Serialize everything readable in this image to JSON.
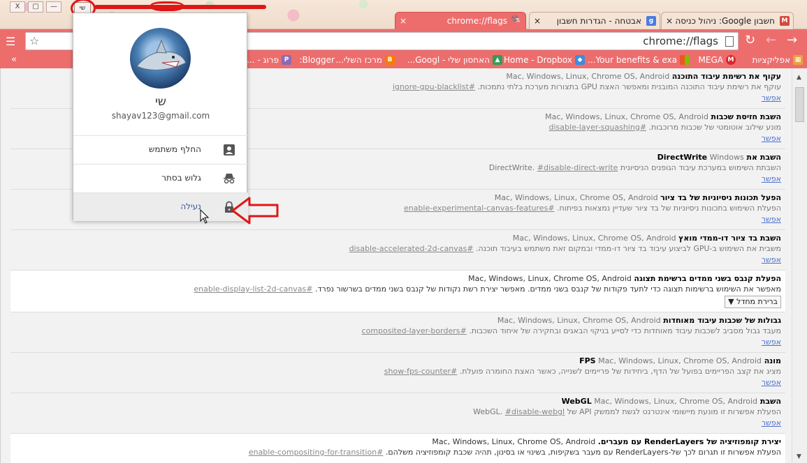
{
  "window": {
    "buttons": [
      "X",
      "▢",
      "—"
    ],
    "profile_button_label": "שי"
  },
  "tabs": [
    {
      "title": "chrome://flags",
      "active": true,
      "favicon": "flags-icon",
      "close": "×"
    },
    {
      "title": "אבטחה - הגדרות חשבון",
      "active": false,
      "favicon": "google-icon",
      "favicon_text": "g",
      "favicon_color": "#4a7de0",
      "close": "×"
    },
    {
      "title": "חשבון Google: ניהול כניסה",
      "active": false,
      "favicon": "gmail-icon",
      "favicon_text": "M",
      "favicon_color": "#d24b3f",
      "close": "×"
    }
  ],
  "toolbar": {
    "url": "chrome://flags",
    "menu_glyph": "☰",
    "star_glyph": "☆",
    "reload_glyph": "↻",
    "back_glyph": "←",
    "forward_glyph": "→"
  },
  "bookmarks": {
    "more": "»",
    "items": [
      {
        "label": "אפליקציות",
        "icon": "apps-icon",
        "color": "#e8a33d",
        "glyph": "▦"
      },
      {
        "label": "MEGA",
        "icon": "mega-icon",
        "color": "#d9272e",
        "glyph": "M"
      },
      {
        "label": "Your benefits & exa...",
        "icon": "microsoft-icon",
        "color": "#7cbb00",
        "glyph": "■"
      },
      {
        "label": "Home - Dropbox",
        "icon": "dropbox-icon",
        "color": "#3d8be0",
        "glyph": "◆"
      },
      {
        "label": "האחסון שלי - Googl...",
        "icon": "drive-icon",
        "color": "#2f9e55",
        "glyph": "▲"
      },
      {
        "label": "מרכז השלי...",
        "icon": "blogger-icon",
        "color": "#f57d00",
        "glyph": "B"
      },
      {
        "label": "Blogger:",
        "icon": "",
        "color": "",
        "glyph": ""
      },
      {
        "label": "פרוג - ...",
        "icon": "prog-icon",
        "color": "#8c6bb1",
        "glyph": "P"
      }
    ]
  },
  "popup": {
    "name": "שי",
    "email": "shayav123@gmail.com",
    "switch_user": "החלף משתמש",
    "incognito": "גלוש בסתר",
    "lock": "נעילה"
  },
  "flags": [
    {
      "title": "עקוף את רשימת עיבוד התוכנה",
      "platforms": "Mac, Windows, Linux, Chrome OS, Android",
      "desc": "עוקף את רשימת עיבוד התוכנה המובנית ומאפשר האצת GPU בתצורות מערכת בלתי נתמכות.",
      "anchor": "#ignore-gpu-blacklist",
      "action": "אפשר",
      "enabled": false
    },
    {
      "title": "השבת חזיסת שכבות",
      "platforms": "Mac, Windows, Linux, Chrome OS, Android",
      "desc": "מונע שילוב אוטומטי של שכבות מרוכבות.",
      "anchor": "#disable-layer-squashing",
      "action": "אפשר",
      "enabled": false
    },
    {
      "title": "השבת את DirectWrite",
      "platforms": "Windows",
      "desc": "השבתת השימוש במערכת עיבוד הגופנים הניסיונית DirectWrite.",
      "anchor": "#disable-direct-write",
      "action": "אפשר",
      "enabled": false
    },
    {
      "title": "הפעל תכונות ניסיוניות של בד ציור",
      "platforms": "Mac, Windows, Linux, Chrome OS, Android",
      "desc": "הפעלת השימוש בתכונות ניסיוניות של בד ציור שעדיין נמצאות בפיתוח.",
      "anchor": "#enable-experimental-canvas-features",
      "action": "אפשר",
      "enabled": false
    },
    {
      "title": "השבת בד ציור דו-ממדי מואץ",
      "platforms": "Mac, Windows, Linux, Chrome OS, Android",
      "desc": "משבית את השימוש ב-GPU לביצוע עיבוד בד ציור דו-ממדי ובמקום זאת משתמש בעיבוד תוכנה.",
      "anchor": "#disable-accelerated-2d-canvas",
      "action": "אפשר",
      "enabled": false
    },
    {
      "title": "הפעלת קנבס בשני ממדים ברשימת תצוגה",
      "platforms": "Mac, Windows, Linux, Chrome OS, Android",
      "desc": "מאפשר את השימוש ברשימות תצוגה כדי לתעד פקודות של קנבס בשני ממדים. מאפשר יצירת רשת נקודות של קנבס בשני ממדים בשרשור נפרד.",
      "anchor": "#enable-display-list-2d-canvas",
      "select": "ברירת מחדל",
      "enabled": true
    },
    {
      "title": "גבולות של שכבות עיבוד מאוחדות",
      "platforms": "Mac, Windows, Linux, Chrome OS, Android",
      "desc": "מעבד גבול מסביב לשכבות עיבוד מאוחדות כדי לסייע בניקוי הבאגים ובחקירה של איחוד השכבות.",
      "anchor": "#composited-layer-borders",
      "action": "אפשר",
      "enabled": false
    },
    {
      "title": "מונה FPS",
      "platforms": "Mac, Windows, Linux, Chrome OS, Android",
      "desc": "מציג את קצב הפריימים בפועל של הדף, ביחידות של פריימים לשנייה, כאשר האצת החומרה פועלת.",
      "anchor": "#show-fps-counter",
      "action": "אפשר",
      "enabled": false
    },
    {
      "title": "השבת WebGL",
      "platforms": "Mac, Windows, Linux, Chrome OS, Android",
      "desc": "הפעלת אפשרות זו מונעת מיישומי אינטרנט לגשת לממשק API של WebGL.",
      "anchor": "#disable-webgl",
      "action": "אפשר",
      "enabled": false
    },
    {
      "title": "יצירת קומפוזיציה של RenderLayers עם מעברים.",
      "platforms": "Mac, Windows, Linux, Chrome OS, Android",
      "desc": "הפעלת אפשרות זו תגרום לכך של-RenderLayers עם מעבר בשקיפות, בשינוי או בסינון, תהיה שכבת קומפוזיציה משלהם.",
      "anchor": "#enable-compositing-for-transition",
      "action": "",
      "enabled": false
    }
  ]
}
